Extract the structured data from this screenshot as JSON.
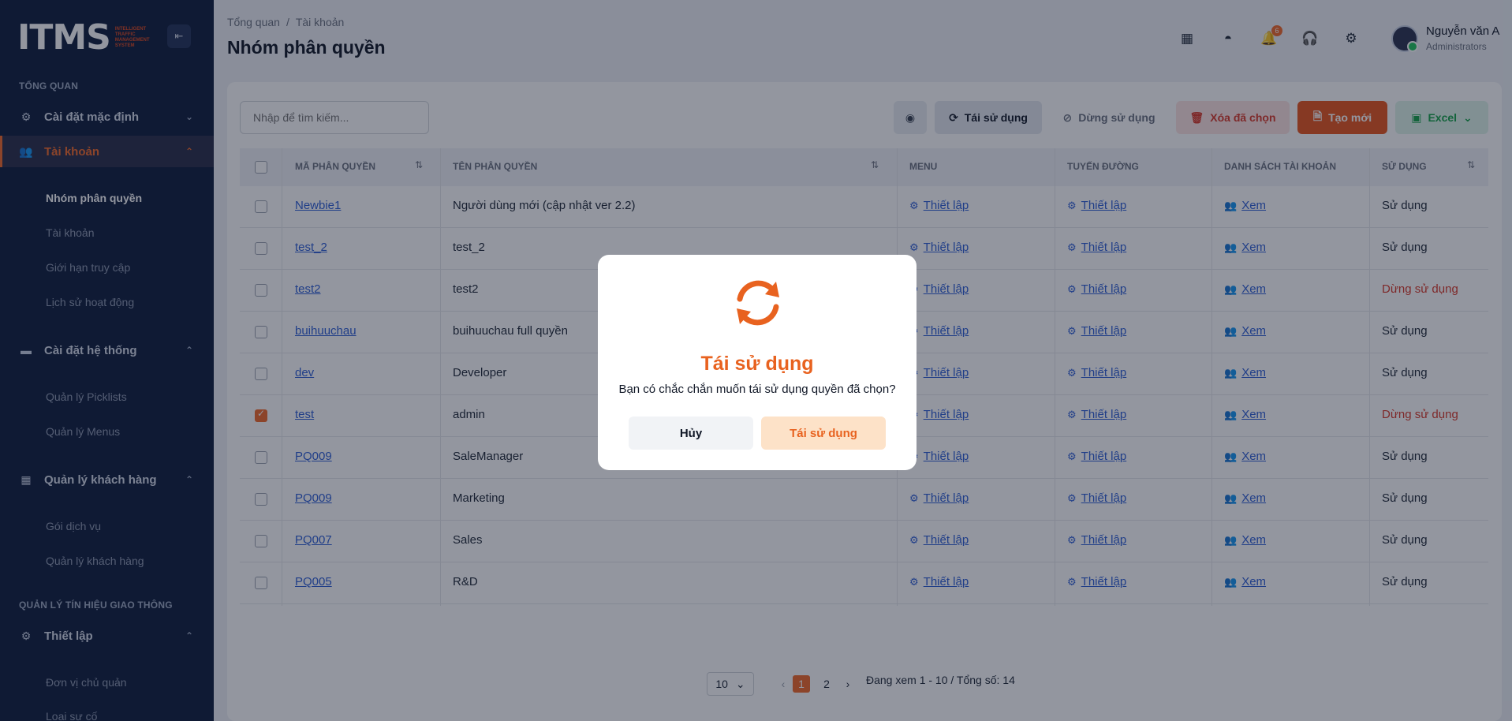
{
  "sidebar": {
    "logo_main": "ITMS",
    "logo_sub": "INTELLIGENT TRAFFIC MANAGEMENT SYSTEM",
    "section_overview": "TỔNG QUAN",
    "section_traffic": "QUẢN LÝ TÍN HIỆU GIAO THÔNG",
    "items": [
      {
        "label": "Cài đặt mặc định"
      },
      {
        "label": "Tài khoản"
      },
      {
        "label": "Cài đặt hệ thống"
      },
      {
        "label": "Quản lý khách hàng"
      },
      {
        "label": "Thiết lập"
      }
    ],
    "sub_items": [
      "Nhóm phân quyền",
      "Tài khoản",
      "Giới hạn truy cập",
      "Lịch sử hoạt động",
      "Quản lý Picklists",
      "Quản lý Menus",
      "Gói dịch vụ",
      "Quản lý khách hàng",
      "Đơn vị chủ quản",
      "Loại sự cố"
    ]
  },
  "header": {
    "breadcrumb": [
      "Tổng quan",
      "Tài khoản"
    ],
    "title": "Nhóm phân quyền",
    "notification_count": "6",
    "user_name": "Nguyễn văn A",
    "user_role": "Administrators"
  },
  "toolbar": {
    "search_placeholder": "Nhập để tìm kiếm...",
    "reuse_label": "Tái sử dụng",
    "stop_label": "Dừng sử dụng",
    "delete_label": "Xóa đã chọn",
    "create_label": "Tạo mới",
    "excel_label": "Excel"
  },
  "table": {
    "headers": [
      "MÃ PHÂN QUYỀN",
      "TÊN PHÂN QUYỀN",
      "MENU",
      "TUYẾN ĐƯỜNG",
      "DANH SÁCH TÀI KHOẢN",
      "SỬ DỤNG"
    ],
    "setup_label": "Thiết lập",
    "view_label": "Xem",
    "rows": [
      {
        "code": "Newbie1",
        "name": "Người dùng mới (cập nhật ver 2.2)",
        "status": "Sử dụng",
        "checked": false
      },
      {
        "code": "test_2",
        "name": "test_2",
        "status": "Sử dụng",
        "checked": false
      },
      {
        "code": "test2",
        "name": "test2",
        "status": "Dừng sử dụng",
        "checked": false
      },
      {
        "code": "buihuuchau",
        "name": "buihuuchau full quyền",
        "status": "Sử dụng",
        "checked": false
      },
      {
        "code": "dev",
        "name": "Developer",
        "status": "Sử dụng",
        "checked": false
      },
      {
        "code": "test",
        "name": "admin",
        "status": "Dừng sử dụng",
        "checked": true
      },
      {
        "code": "PQ009",
        "name": "SaleManager",
        "status": "Sử dụng",
        "checked": false
      },
      {
        "code": "PQ009",
        "name": "Marketing",
        "status": "Sử dụng",
        "checked": false
      },
      {
        "code": "PQ007",
        "name": "Sales",
        "status": "Sử dụng",
        "checked": false
      },
      {
        "code": "PQ005",
        "name": "R&D",
        "status": "Sử dụng",
        "checked": false
      }
    ]
  },
  "pagination": {
    "page_size": "10",
    "pages": [
      "1",
      "2"
    ],
    "current_page": "1",
    "summary": "Đang xem 1 - 10 / Tổng số: 14"
  },
  "modal": {
    "title": "Tái sử dụng",
    "message": "Bạn có chắc chắn muốn tái sử dụng quyền đã chọn?",
    "cancel_label": "Hủy",
    "confirm_label": "Tái sử dụng"
  },
  "colors": {
    "accent": "#f26b2a",
    "danger": "#d93a2a",
    "sidebar_bg": "#0f1e3d",
    "link": "#2f5fd6"
  }
}
